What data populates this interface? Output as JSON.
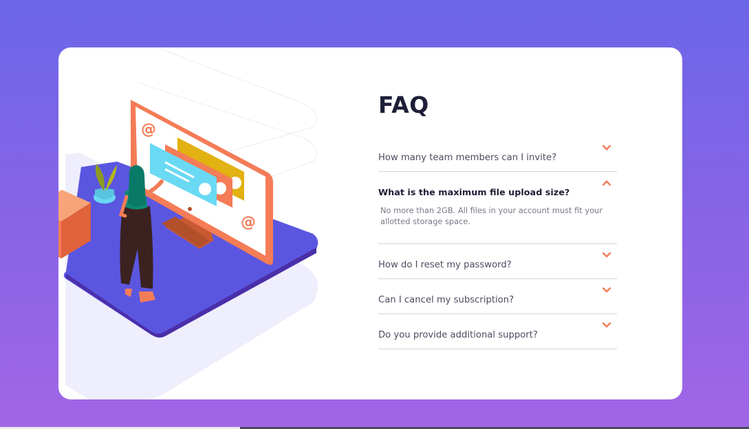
{
  "faq": {
    "title": "FAQ",
    "items": [
      {
        "question": "How many team members can I invite?",
        "expanded": false
      },
      {
        "question": "What is the maximum file upload size?",
        "expanded": true,
        "answer": "No more than 2GB. All files in your account must fit your allotted storage space."
      },
      {
        "question": "How do I reset my password?",
        "expanded": false
      },
      {
        "question": "Can I cancel my subscription?",
        "expanded": false
      },
      {
        "question": "Do you provide additional support?",
        "expanded": false
      }
    ]
  },
  "icons": {
    "chevron": "chevron-down-icon",
    "chevron_open": "chevron-up-icon"
  },
  "colors": {
    "accent": "#f47c57",
    "heading": "#1e1f36",
    "text": "#4b4c5f",
    "platform": "#5b56e0",
    "background_top": "#6c66e8",
    "background_bottom": "#a166e6"
  }
}
